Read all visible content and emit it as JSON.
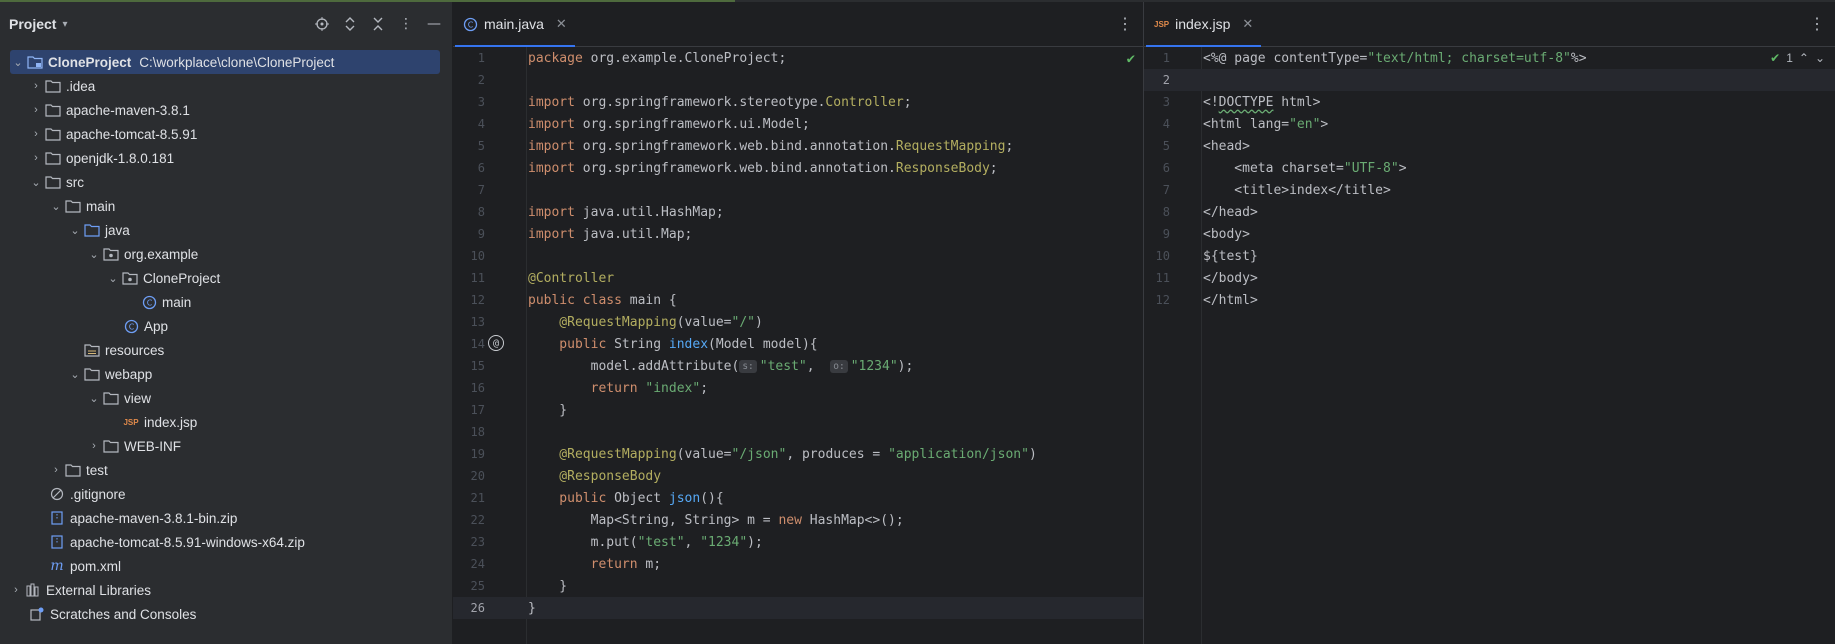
{
  "project": {
    "title": "Project",
    "root": {
      "name": "CloneProject",
      "path": "C:\\workplace\\clone\\CloneProject"
    },
    "items": [
      {
        "label": ".idea"
      },
      {
        "label": "apache-maven-3.8.1"
      },
      {
        "label": "apache-tomcat-8.5.91"
      },
      {
        "label": "openjdk-1.8.0.181"
      },
      {
        "label": "src"
      },
      {
        "label": "main"
      },
      {
        "label": "java"
      },
      {
        "label": "org.example"
      },
      {
        "label": "CloneProject"
      },
      {
        "label": "main"
      },
      {
        "label": "App"
      },
      {
        "label": "resources"
      },
      {
        "label": "webapp"
      },
      {
        "label": "view"
      },
      {
        "label": "index.jsp"
      },
      {
        "label": "WEB-INF"
      },
      {
        "label": "test"
      },
      {
        "label": ".gitignore"
      },
      {
        "label": "apache-maven-3.8.1-bin.zip"
      },
      {
        "label": "apache-tomcat-8.5.91-windows-x64.zip"
      },
      {
        "label": "pom.xml"
      },
      {
        "label": "External Libraries"
      },
      {
        "label": "Scratches and Consoles"
      }
    ]
  },
  "editor1": {
    "tab": "main.java",
    "lines": [
      "1",
      "2",
      "3",
      "4",
      "5",
      "6",
      "7",
      "8",
      "9",
      "10",
      "11",
      "12",
      "13",
      "14",
      "15",
      "16",
      "17",
      "18",
      "19",
      "20",
      "21",
      "22",
      "23",
      "24",
      "25",
      "26"
    ],
    "tokens": {
      "l1a": "package",
      "l1b": " org.example.CloneProject;",
      "l3a": "import",
      "l3b": " org.springframework.stereotype.",
      "l3c": "Controller",
      "l3d": ";",
      "l4a": "import",
      "l4b": " org.springframework.ui.Model;",
      "l5a": "import",
      "l5b": " org.springframework.web.bind.annotation.",
      "l5c": "RequestMapping",
      "l5d": ";",
      "l6a": "import",
      "l6b": " org.springframework.web.bind.annotation.",
      "l6c": "ResponseBody",
      "l6d": ";",
      "l8a": "import",
      "l8b": " java.util.HashMap;",
      "l9a": "import",
      "l9b": " java.util.Map;",
      "l11a": "@Controller",
      "l12a": "public class",
      "l12b": " main {",
      "l13a": "    @RequestMapping",
      "l13b": "(value=",
      "l13c": "\"/\"",
      "l13d": ")",
      "l14a": "    public",
      "l14b": " String ",
      "l14c": "index",
      "l14d": "(Model model){",
      "l15a": "        model.addAttribute(",
      "l15h1": "s:",
      "l15b": "\"test\"",
      "l15c": ",  ",
      "l15h2": "o:",
      "l15d": "\"1234\"",
      "l15e": ");",
      "l16a": "        return",
      "l16b": " ",
      "l16c": "\"index\"",
      "l16d": ";",
      "l17a": "    }",
      "l19a": "    @RequestMapping",
      "l19b": "(value=",
      "l19c": "\"/json\"",
      "l19d": ", produces = ",
      "l19e": "\"application/json\"",
      "l19f": ")",
      "l20a": "    @ResponseBody",
      "l21a": "    public",
      "l21b": " Object ",
      "l21c": "json",
      "l21d": "(){",
      "l22a": "        Map<String, String> m = ",
      "l22b": "new",
      "l22c": " HashMap<>();",
      "l23a": "        m.put(",
      "l23b": "\"test\"",
      "l23c": ", ",
      "l23d": "\"1234\"",
      "l23e": ");",
      "l24a": "        return",
      "l24b": " m;",
      "l25a": "    }",
      "l26a": "}"
    }
  },
  "editor2": {
    "tab": "index.jsp",
    "inspection_count": "1",
    "lines": [
      "1",
      "2",
      "3",
      "4",
      "5",
      "6",
      "7",
      "8",
      "9",
      "10",
      "11",
      "12"
    ],
    "tokens": {
      "l1a": "<%@ page contentType=",
      "l1b": "\"text/html; charset=utf-8\"",
      "l1c": "%>",
      "l3a": "<!",
      "l3b": "DOCTYPE",
      "l3c": " html>",
      "l4a": "<html lang=",
      "l4b": "\"en\"",
      "l4c": ">",
      "l5a": "<head>",
      "l6a": "    <meta charset=",
      "l6b": "\"UTF-8\"",
      "l6c": ">",
      "l7a": "    <title>index</title>",
      "l8a": "</head>",
      "l9a": "<body>",
      "l10a": "${test}",
      "l11a": "</body>",
      "l12a": "</html>"
    }
  },
  "colors": {
    "selection": "#2e436e",
    "keyword": "#cf8e6d",
    "string": "#6aab73",
    "annotation": "#b3ae60",
    "function": "#56a8f5",
    "accent": "#3574f0"
  }
}
